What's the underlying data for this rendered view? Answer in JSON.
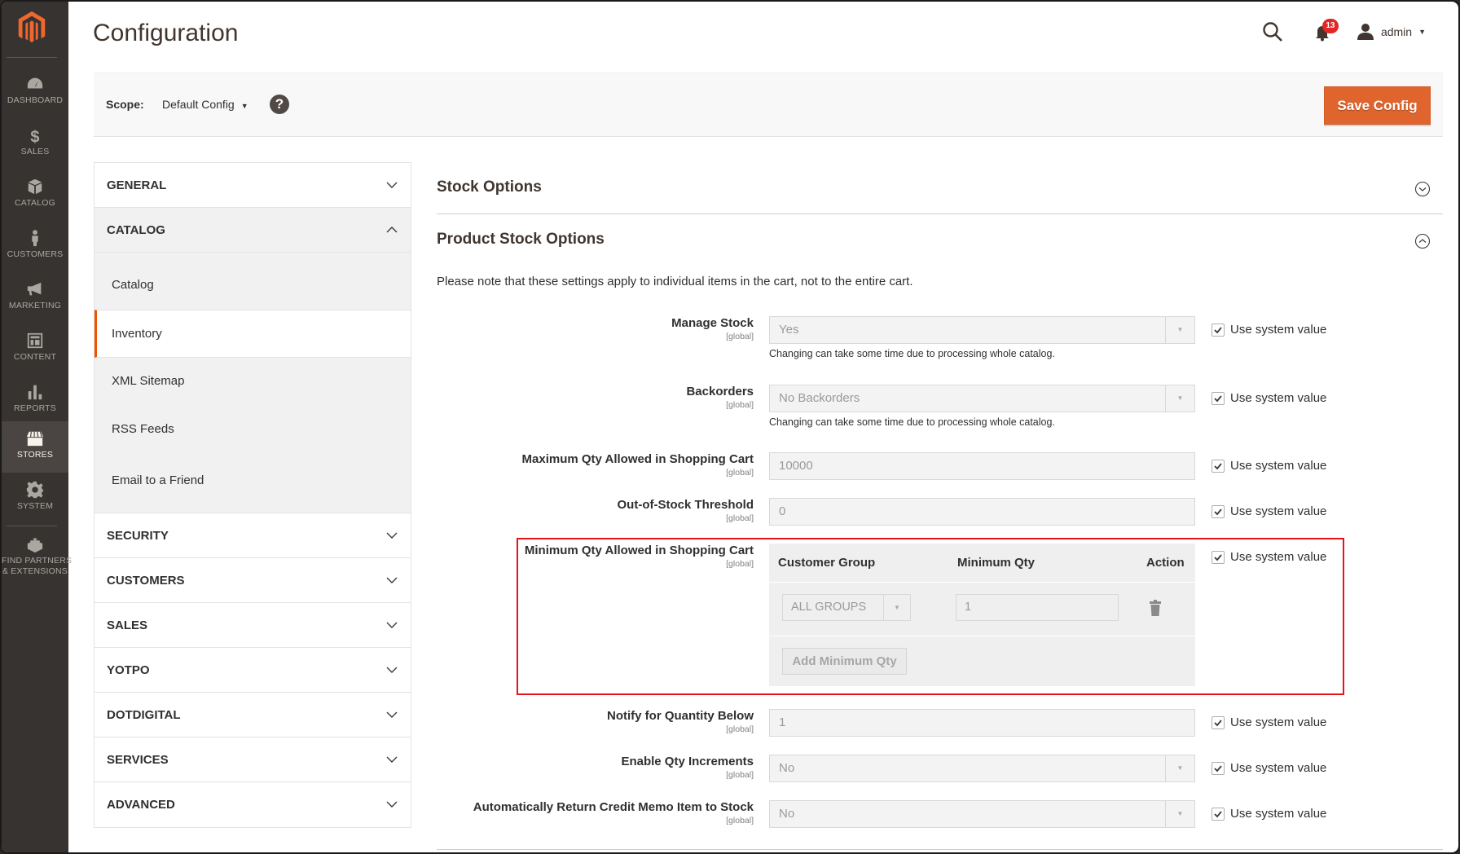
{
  "sidebar": {
    "items": [
      {
        "label": "DASHBOARD",
        "icon": "dashboard-icon"
      },
      {
        "label": "SALES",
        "icon": "dollar-icon"
      },
      {
        "label": "CATALOG",
        "icon": "box-icon"
      },
      {
        "label": "CUSTOMERS",
        "icon": "person-icon"
      },
      {
        "label": "MARKETING",
        "icon": "megaphone-icon"
      },
      {
        "label": "CONTENT",
        "icon": "layout-icon"
      },
      {
        "label": "REPORTS",
        "icon": "bar-chart-icon"
      },
      {
        "label": "STORES",
        "icon": "storefront-icon",
        "active": true
      },
      {
        "label": "SYSTEM",
        "icon": "gear-icon"
      },
      {
        "label_line1": "FIND PARTNERS",
        "label_line2": "& EXTENSIONS",
        "icon": "lego-brick-icon"
      }
    ]
  },
  "header": {
    "title": "Configuration",
    "notification_count": "13",
    "user_name": "admin"
  },
  "scope": {
    "label": "Scope:",
    "value": "Default Config",
    "help": "?",
    "save_label": "Save Config"
  },
  "config_nav": {
    "tabs": [
      {
        "label": "GENERAL",
        "open": false
      },
      {
        "label": "CATALOG",
        "open": true,
        "items": [
          "Catalog",
          "Inventory",
          "XML Sitemap",
          "RSS Feeds",
          "Email to a Friend"
        ],
        "active_item": "Inventory"
      },
      {
        "label": "SECURITY",
        "open": false
      },
      {
        "label": "CUSTOMERS",
        "open": false
      },
      {
        "label": "SALES",
        "open": false
      },
      {
        "label": "YOTPO",
        "open": false
      },
      {
        "label": "DOTDIGITAL",
        "open": false
      },
      {
        "label": "SERVICES",
        "open": false
      },
      {
        "label": "ADVANCED",
        "open": false
      }
    ]
  },
  "sections": {
    "stock_options": {
      "title": "Stock Options",
      "expanded": false
    },
    "product_stock_options": {
      "title": "Product Stock Options",
      "expanded": true,
      "note": "Please note that these settings apply to individual items in the cart, not to the entire cart."
    }
  },
  "fields": {
    "use_system_label": "Use system value",
    "scope_tag": "[global]",
    "manage_stock": {
      "label": "Manage Stock",
      "value": "Yes",
      "hint": "Changing can take some time due to processing whole catalog.",
      "use_system": true
    },
    "backorders": {
      "label": "Backorders",
      "value": "No Backorders",
      "hint": "Changing can take some time due to processing whole catalog.",
      "use_system": true
    },
    "max_qty": {
      "label": "Maximum Qty Allowed in Shopping Cart",
      "value": "10000",
      "use_system": true
    },
    "out_of_stock": {
      "label": "Out-of-Stock Threshold",
      "value": "0",
      "use_system": true
    },
    "min_qty": {
      "label": "Minimum Qty Allowed in Shopping Cart",
      "use_system": true,
      "columns": [
        "Customer Group",
        "Minimum Qty",
        "Action"
      ],
      "rows": [
        {
          "group": "ALL GROUPS",
          "qty": "1"
        }
      ],
      "add_label": "Add Minimum Qty"
    },
    "notify_below": {
      "label": "Notify for Quantity Below",
      "value": "1",
      "use_system": true
    },
    "qty_increments": {
      "label": "Enable Qty Increments",
      "value": "No",
      "use_system": true
    },
    "auto_return": {
      "label": "Automatically Return Credit Memo Item to Stock",
      "value": "No",
      "use_system": true
    }
  },
  "colors": {
    "accent": "#eb5202",
    "save_button": "#e0642d",
    "sidebar_bg": "#373330",
    "highlight_box": "#e8121b"
  }
}
